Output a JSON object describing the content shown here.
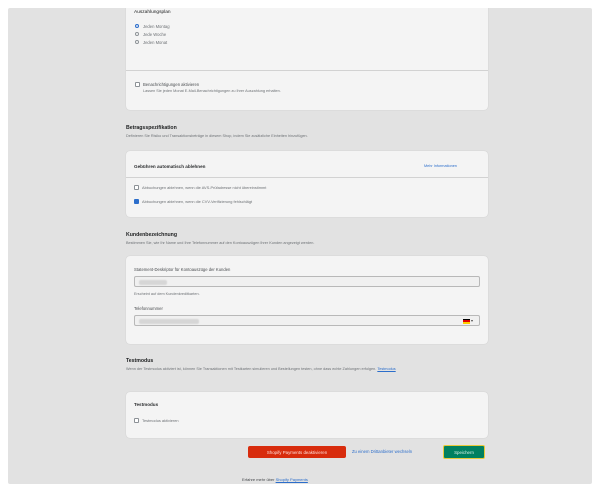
{
  "schedule": {
    "heading": "Auszahlungsplan",
    "options": [
      "Jeden Montag",
      "Jede Woche",
      "Jeden Monat"
    ],
    "selected_index": 0,
    "notify_label": "Benachrichtigungen aktivieren",
    "notify_help": "Lassen Sie jeden Monat E-Mail-Benachrichtigungen zu Ihrer Auszahlung erhalten."
  },
  "fee_section": {
    "title": "Betragsspezifikation",
    "description": "Definieren Sie Risiko und Transaktionsbeträge in diesem Shop, indem Sie zusätzliche Einheiten hinzufügen.",
    "card_title": "Gebühren automatisch ablehnen",
    "more_link": "Mehr Informationen",
    "option1": "Abbuchungen ablehnen, wenn die AVS-Prüfadresse nicht übereinstimmt",
    "option1_checked": false,
    "option2": "Abbuchungen ablehnen, wenn die CVV-Verifizierung fehlschlägt",
    "option2_checked": true
  },
  "customer_section": {
    "title": "Kundenbezeichnung",
    "description": "Bestimmen Sie, wie Ihr Name und Ihre Telefonnummer auf den Kontoauszügen Ihrer Kunden angezeigt werden.",
    "statement_label": "Statement-Deskriptor für Kontoauszüge der Kunden",
    "statement_value": "",
    "statement_help": "Erscheint auf dem Kundenkreditkarten.",
    "phone_label": "Telefonnummer",
    "phone_value": "",
    "flag": "DE"
  },
  "test_section": {
    "title": "Testmodus",
    "description_prefix": "Wenn der Testmodus aktiviert ist, können Sie Transaktionen mit Testkarten simulieren und Bestellungen testen, ohne dass echte Zahlungen erfolgen.",
    "description_link": "Testmodus",
    "card_title": "Testmodus",
    "checkbox_label": "Testmodus aktivieren",
    "checked": false
  },
  "actions": {
    "deactivate": "Shopify Payments deaktivieren",
    "switch": "Zu einem Drittanbieter wechseln",
    "save": "Speichern"
  },
  "footer": {
    "prefix": "Erfahre mehr über",
    "link": "Shopify Payments"
  }
}
